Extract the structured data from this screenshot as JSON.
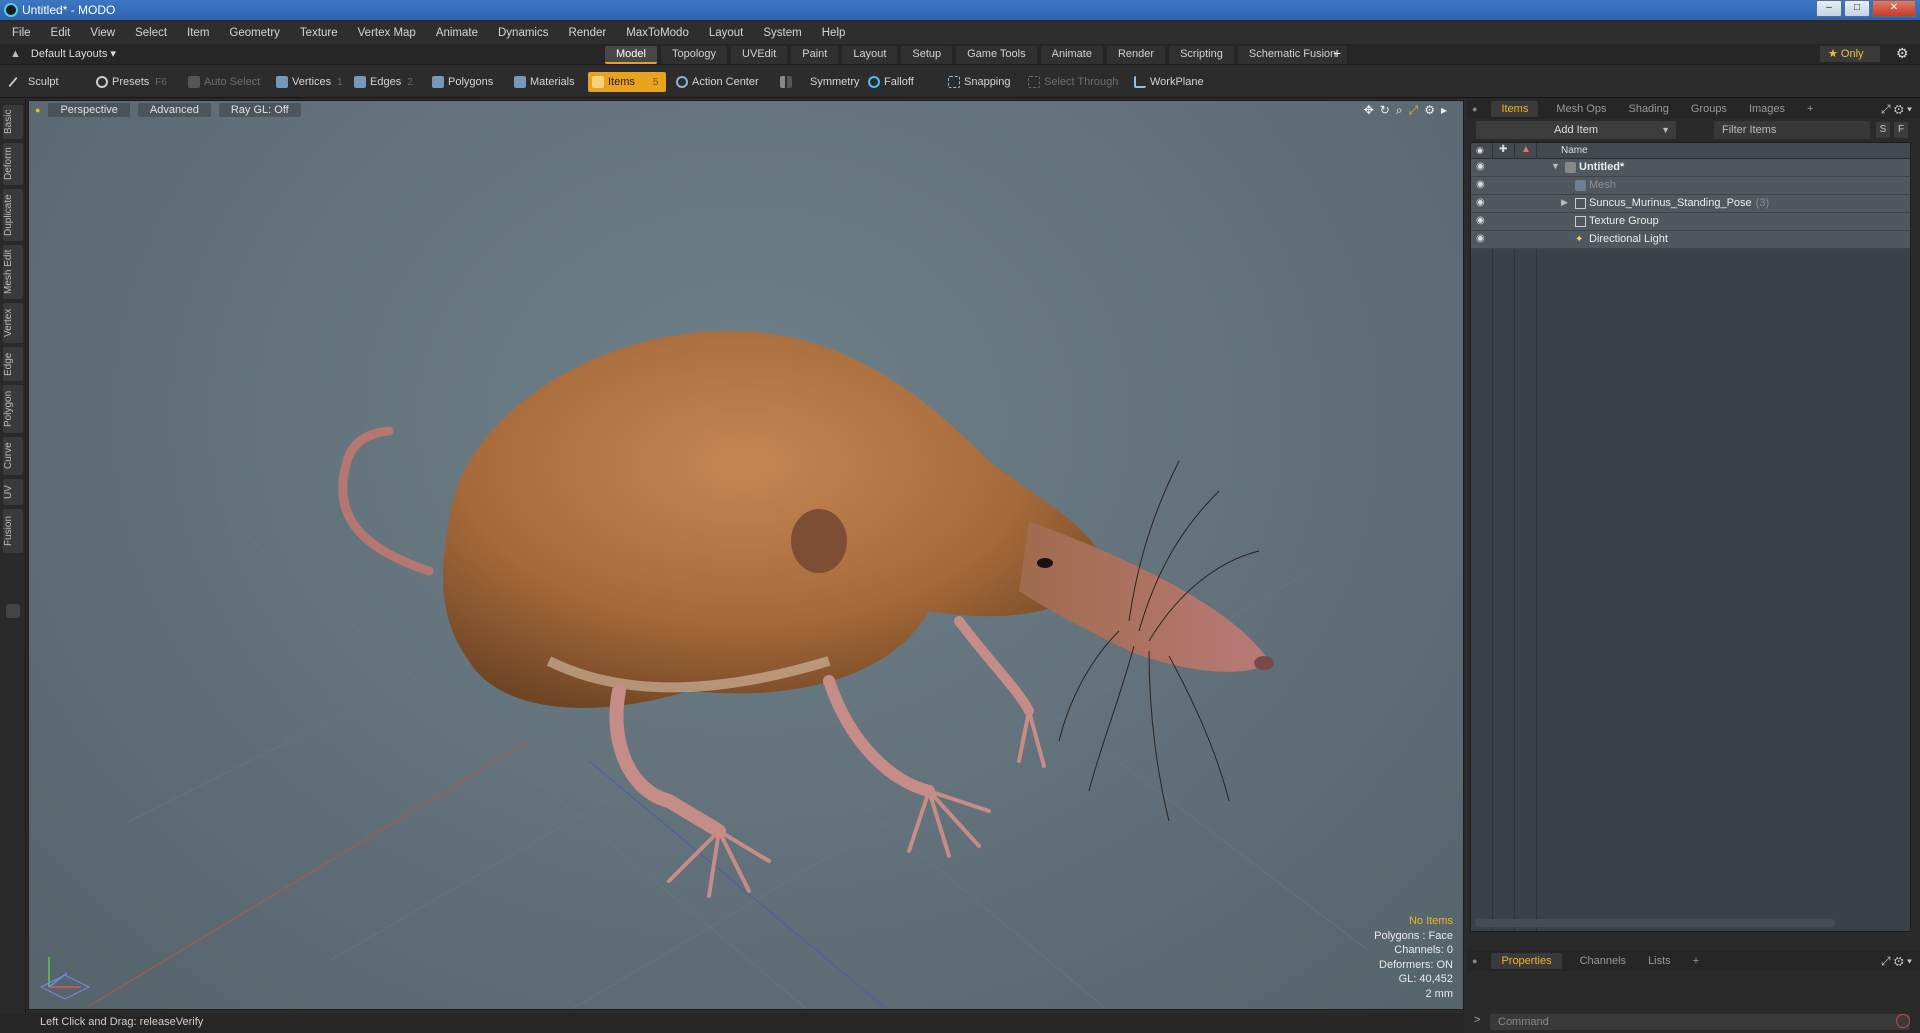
{
  "window": {
    "title": "Untitled* - MODO"
  },
  "menu": [
    "File",
    "Edit",
    "View",
    "Select",
    "Item",
    "Geometry",
    "Texture",
    "Vertex Map",
    "Animate",
    "Dynamics",
    "Render",
    "MaxToModo",
    "Layout",
    "System",
    "Help"
  ],
  "layoutbar": {
    "layout_select": "Default Layouts ▾",
    "tabs": [
      "Model",
      "Topology",
      "UVEdit",
      "Paint",
      "Layout",
      "Setup",
      "Game Tools",
      "Animate",
      "Render",
      "Scripting",
      "Schematic Fusion"
    ],
    "active_tab": "Model",
    "plus": "+",
    "only_label": "★  Only"
  },
  "toolbar": {
    "sculpt": "Sculpt",
    "presets": "Presets",
    "presets_key": "F6",
    "auto_select": "Auto Select",
    "vertices": "Vertices",
    "vertices_key": "1",
    "edges": "Edges",
    "edges_key": "2",
    "polygons": "Polygons",
    "materials": "Materials",
    "items": "Items",
    "items_key": "5",
    "action_center": "Action Center",
    "symmetry": "Symmetry",
    "falloff": "Falloff",
    "snapping": "Snapping",
    "select_through": "Select Through",
    "workplane": "WorkPlane"
  },
  "left_tabs": [
    "Basic",
    "Deform",
    "Duplicate",
    "Mesh Edit",
    "Vertex",
    "Edge",
    "Polygon",
    "Curve",
    "UV",
    "Fusion"
  ],
  "viewport": {
    "perspective": "Perspective",
    "advanced": "Advanced",
    "raygl": "Ray GL: Off",
    "stats": {
      "no_items": "No Items",
      "polygons": "Polygons : Face",
      "channels": "Channels: 0",
      "deformers": "Deformers: ON",
      "gl": "GL: 40,452",
      "scale": "2 mm"
    }
  },
  "statusbar": {
    "text": "Left Click and Drag:   releaseVerify"
  },
  "rightpanel": {
    "tabs": [
      "Items",
      "Mesh Ops",
      "Shading",
      "Groups",
      "Images"
    ],
    "active_tab": "Items",
    "plus": "+",
    "add_item": "Add Item",
    "filter_placeholder": "Filter Items",
    "s_btn": "S",
    "f_btn": "F",
    "name_header": "Name",
    "items": [
      {
        "label": "Untitled*",
        "count": ""
      },
      {
        "label": "Mesh",
        "count": ""
      },
      {
        "label": "Suncus_Murinus_Standing_Pose",
        "count": "(3)"
      },
      {
        "label": "Texture Group",
        "count": ""
      },
      {
        "label": "Directional Light",
        "count": ""
      }
    ],
    "bottom_tabs": [
      "Properties",
      "Channels",
      "Lists"
    ],
    "bottom_active": "Properties",
    "command_placeholder": "Command"
  },
  "colors": {
    "accent": "#e8a21e",
    "viewport": "#617079",
    "selected_text": "#f0b428"
  }
}
